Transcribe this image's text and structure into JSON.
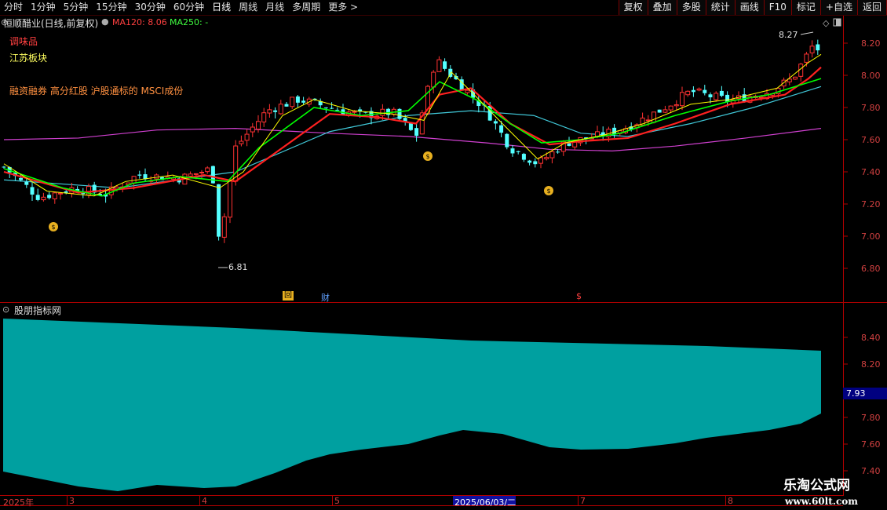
{
  "toolbar": {
    "tabs": [
      "分时",
      "1分钟",
      "5分钟",
      "15分钟",
      "30分钟",
      "60分钟",
      "日线",
      "周线",
      "月线",
      "多周期",
      "更多 >"
    ],
    "active_tab": "日线",
    "tools": [
      "复权",
      "叠加",
      "多股",
      "统计",
      "画线",
      "F10",
      "标记",
      "+自选",
      "返回"
    ]
  },
  "stock": {
    "name": "恒顺醋业(日线,前复权)",
    "ma120_label": "MA120: 8.06",
    "ma250_label": "MA250: -",
    "tag1": "调味品",
    "tag2": "江苏板块",
    "concepts": "融资融券 高分红股 沪股通标的 MSCI成份",
    "high_label": "8.27",
    "low_label": "6.81"
  },
  "markers": {
    "hui": "回",
    "cai": "财",
    "dollar": "$"
  },
  "indicator": {
    "title": "股朋指标网",
    "value_badge": "7.93"
  },
  "axis": {
    "price_ticks": [
      "8.20",
      "8.00",
      "7.80",
      "7.60",
      "7.40",
      "7.20",
      "7.00",
      "6.80"
    ],
    "indicator_ticks": [
      "8.40",
      "8.20",
      "7.80",
      "7.60",
      "7.40"
    ],
    "dates": [
      "2025年",
      "3",
      "4",
      "5",
      "2025/06/03/二",
      "7",
      "8"
    ]
  },
  "watermark": {
    "title": "乐淘公式网",
    "url": "www.60lt.com"
  },
  "colors": {
    "up": "#ff3232",
    "down": "#54ffff",
    "ma5": "#ffff00",
    "ma10": "#00ff00",
    "ma20": "#ff2020",
    "ma60": "#40c8d8",
    "ma120": "#d040d0",
    "area": "#00a0a0",
    "frame": "#b00000"
  }
}
